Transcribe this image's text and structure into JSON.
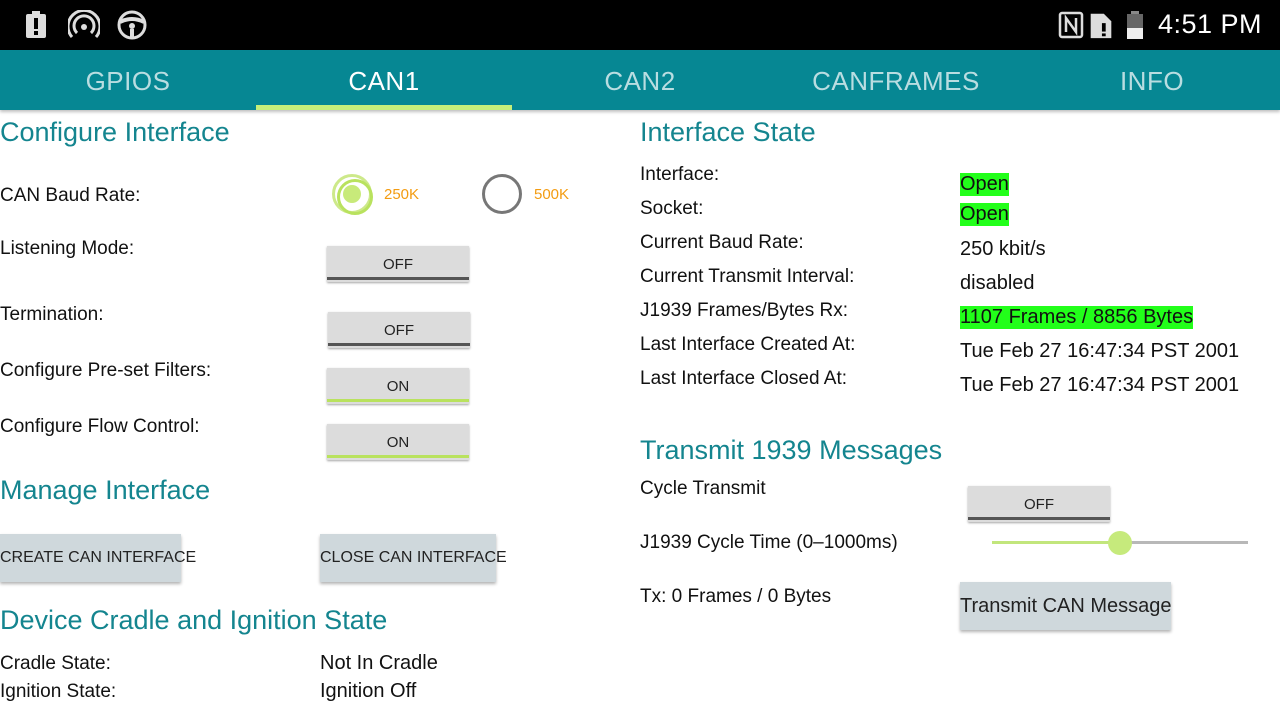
{
  "status_bar": {
    "time": "4:51 PM",
    "left_icons": [
      "alert-icon",
      "hotspot-icon",
      "steering-wheel-icon"
    ],
    "right_icons": [
      "nfc-icon",
      "sim-alert-icon",
      "battery-icon"
    ]
  },
  "tabs": [
    {
      "label": "GPIOS",
      "active": false
    },
    {
      "label": "CAN1",
      "active": true
    },
    {
      "label": "CAN2",
      "active": false
    },
    {
      "label": "CANFRAMES",
      "active": false
    },
    {
      "label": "INFO",
      "active": false
    }
  ],
  "configure": {
    "heading": "Configure Interface",
    "baud_label": "CAN Baud Rate:",
    "baud_options": [
      {
        "label": "250K",
        "selected": true
      },
      {
        "label": "500K",
        "selected": false
      }
    ],
    "listening_label": "Listening Mode:",
    "listening_value": "OFF",
    "termination_label": "Termination:",
    "termination_value": "OFF",
    "filters_label": "Configure Pre-set Filters:",
    "filters_value": "ON",
    "flow_label": "Configure Flow Control:",
    "flow_value": "ON"
  },
  "manage": {
    "heading": "Manage Interface",
    "create_label": "CREATE CAN INTERFACE",
    "close_label": "CLOSE CAN INTERFACE"
  },
  "cradle": {
    "heading": "Device Cradle and Ignition State",
    "cradle_label": "Cradle State:",
    "cradle_value": "Not In Cradle",
    "ignition_label": "Ignition State:",
    "ignition_value": "Ignition Off"
  },
  "state": {
    "heading": "Interface State",
    "rows": [
      {
        "label": "Interface:",
        "value": "Open",
        "highlight": true
      },
      {
        "label": "Socket:",
        "value": "Open",
        "highlight": true
      },
      {
        "label": "Current Baud Rate:",
        "value": "250 kbit/s",
        "highlight": false
      },
      {
        "label": "Current Transmit Interval:",
        "value": "disabled",
        "highlight": false
      },
      {
        "label": "J1939 Frames/Bytes Rx:",
        "value": "1107 Frames / 8856 Bytes",
        "highlight": true
      },
      {
        "label": "Last Interface Created At:",
        "value": "Tue Feb 27 16:47:34 PST 2001",
        "highlight": false
      },
      {
        "label": "Last Interface Closed At:",
        "value": "Tue Feb 27 16:47:34 PST 2001",
        "highlight": false
      }
    ]
  },
  "transmit": {
    "heading": "Transmit 1939 Messages",
    "cycle_label": "Cycle Transmit",
    "cycle_value": "OFF",
    "cycle_time_label": "J1939 Cycle Time (0–1000ms)",
    "cycle_time_fraction": 0.5,
    "tx_label": "Tx: 0 Frames / 0 Bytes",
    "transmit_button": "Transmit CAN Message"
  },
  "colors": {
    "accent": "#068793",
    "heading": "#14858f",
    "highlight": "#22ff1a",
    "toggle_on": "#b9e25e",
    "radio_label": "#f39c12"
  }
}
